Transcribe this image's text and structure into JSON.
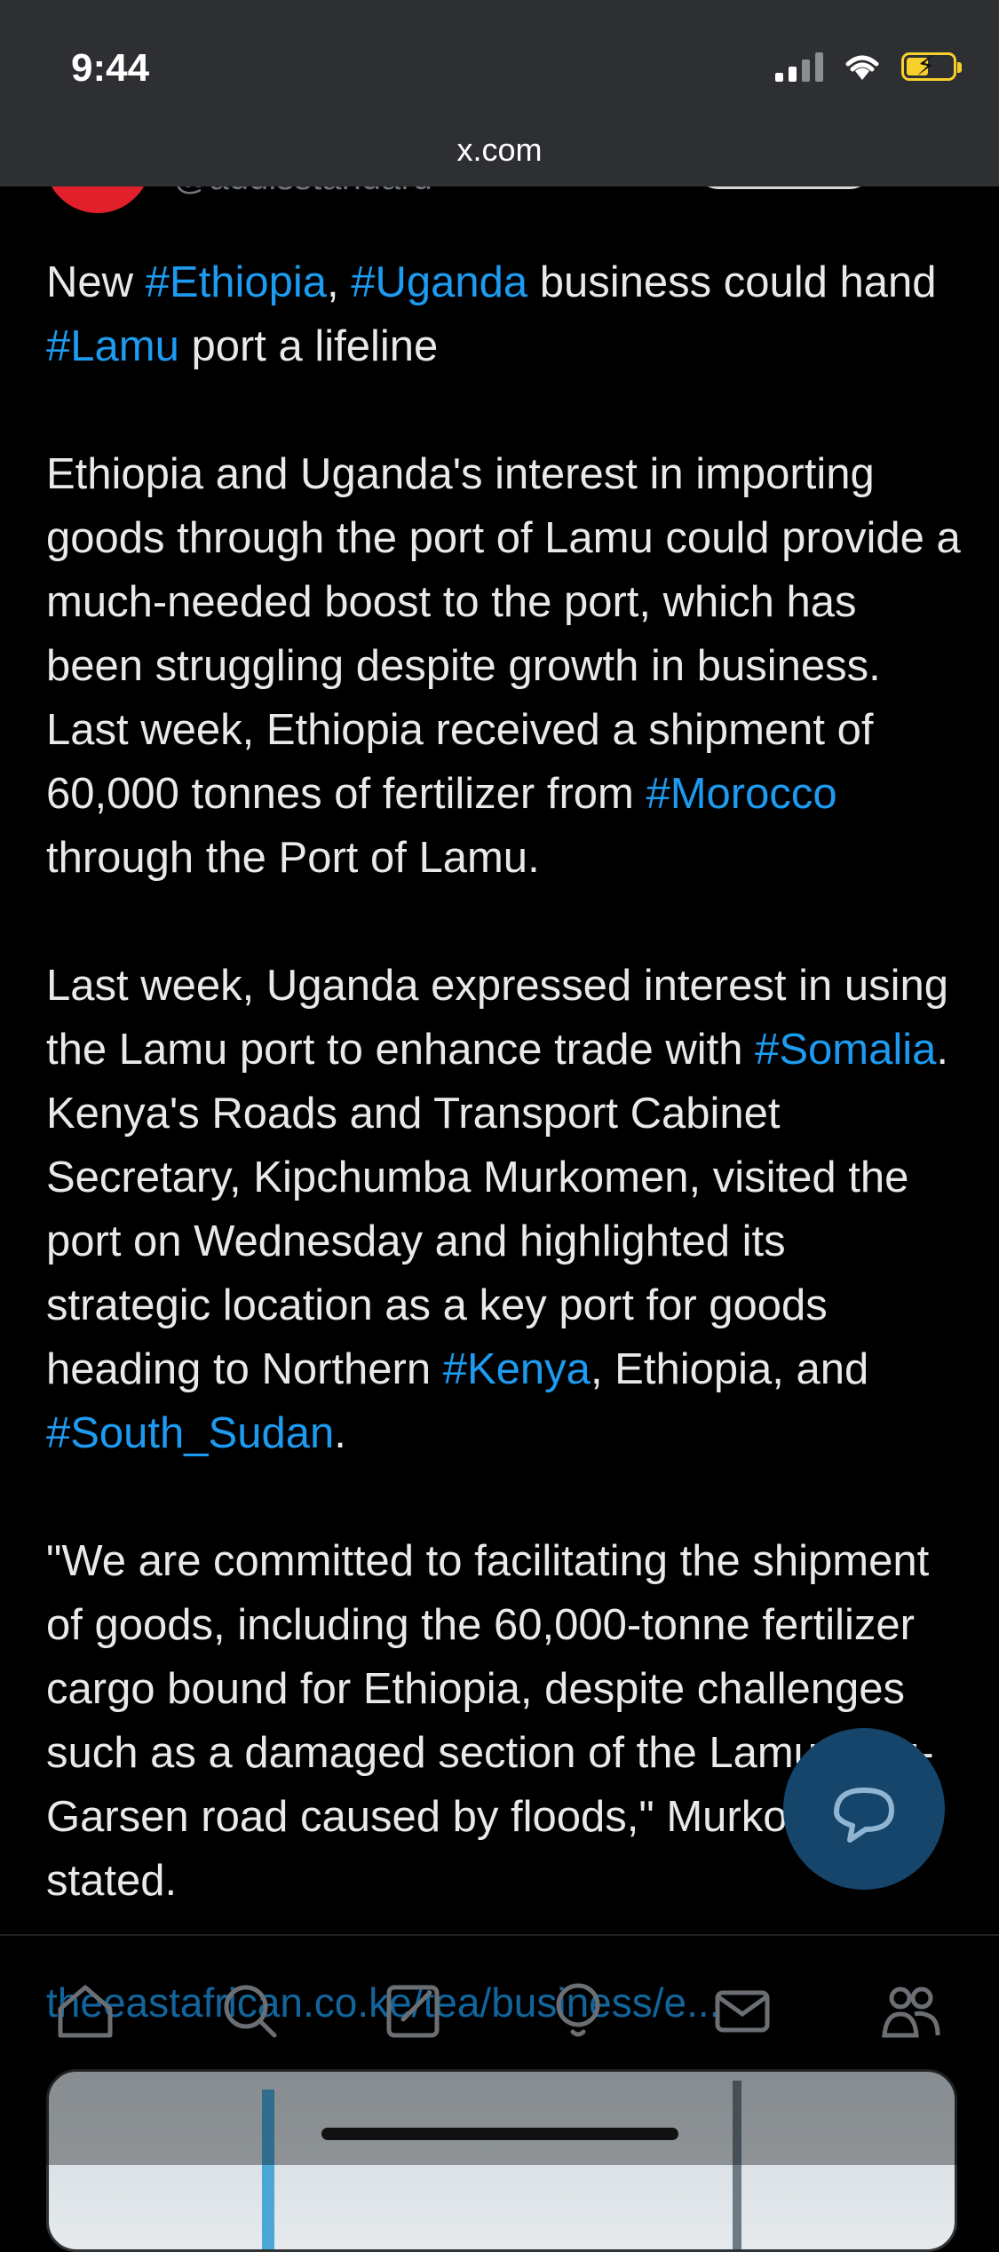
{
  "status_bar": {
    "time": "9:44"
  },
  "browser": {
    "url": "x.com"
  },
  "tweet": {
    "handle": "@addisstandard",
    "paragraphs": [
      [
        {
          "t": "New "
        },
        {
          "t": "#Ethiopia",
          "tag": true
        },
        {
          "t": ", "
        },
        {
          "t": "#Uganda",
          "tag": true
        },
        {
          "t": " business could hand "
        },
        {
          "t": "#Lamu",
          "tag": true
        },
        {
          "t": " port a lifeline"
        }
      ],
      [
        {
          "t": "Ethiopia and Uganda's interest in importing goods through the port of Lamu could provide a much-needed boost to the port, which has been struggling despite growth in business. Last week, Ethiopia received a shipment of 60,000 tonnes of fertilizer from "
        },
        {
          "t": "#Morocco",
          "tag": true
        },
        {
          "t": " through the Port of Lamu."
        }
      ],
      [
        {
          "t": "Last week, Uganda expressed interest in using the Lamu port to enhance trade with "
        },
        {
          "t": "#Somalia",
          "tag": true
        },
        {
          "t": ". Kenya's Roads and Transport Cabinet Secretary, Kipchumba Murkomen, visited the port on Wednesday and highlighted its strategic location as a key port for goods heading to Northern "
        },
        {
          "t": "#Kenya",
          "tag": true
        },
        {
          "t": ", Ethiopia, and "
        },
        {
          "t": "#South_Sudan",
          "tag": true
        },
        {
          "t": "."
        }
      ],
      [
        {
          "t": "\"We are committed to facilitating the shipment of goods, including the 60,000-tonne fertilizer cargo bound for Ethiopia, despite challenges such as a damaged section of the Lamu-Witu-Garsen road caused by floods,\" Murkomen stated."
        }
      ]
    ],
    "link_text": "theeastafrican.co.ke/tea/business/e..."
  },
  "colors": {
    "hashtag": "#1d9bf0",
    "topbar": "#2d2f33",
    "fab": "#16456b"
  },
  "nav_icons": [
    "home-icon",
    "search-icon",
    "compose-icon",
    "spaces-icon",
    "messages-icon",
    "communities-icon"
  ]
}
